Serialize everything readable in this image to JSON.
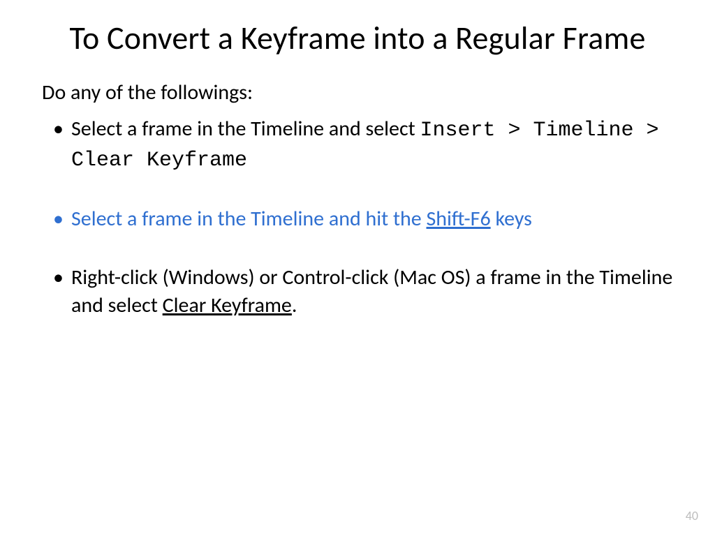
{
  "title": "To Convert a Keyframe into a Regular Frame",
  "intro": "Do any of the followings:",
  "bullets": {
    "item1_pre": "Select a frame in the Timeline and select ",
    "item1_code": "Insert > Timeline > Clear Keyframe",
    "item2_pre": "Select a frame in the Timeline and hit the ",
    "item2_key": "Shift-F6",
    "item2_post": " keys",
    "item3_pre": "Right-click (Windows) or Control-click (Mac OS) a frame in the Timeline and select ",
    "item3_cmd": "Clear Keyframe",
    "item3_post": "."
  },
  "page_number": "40"
}
